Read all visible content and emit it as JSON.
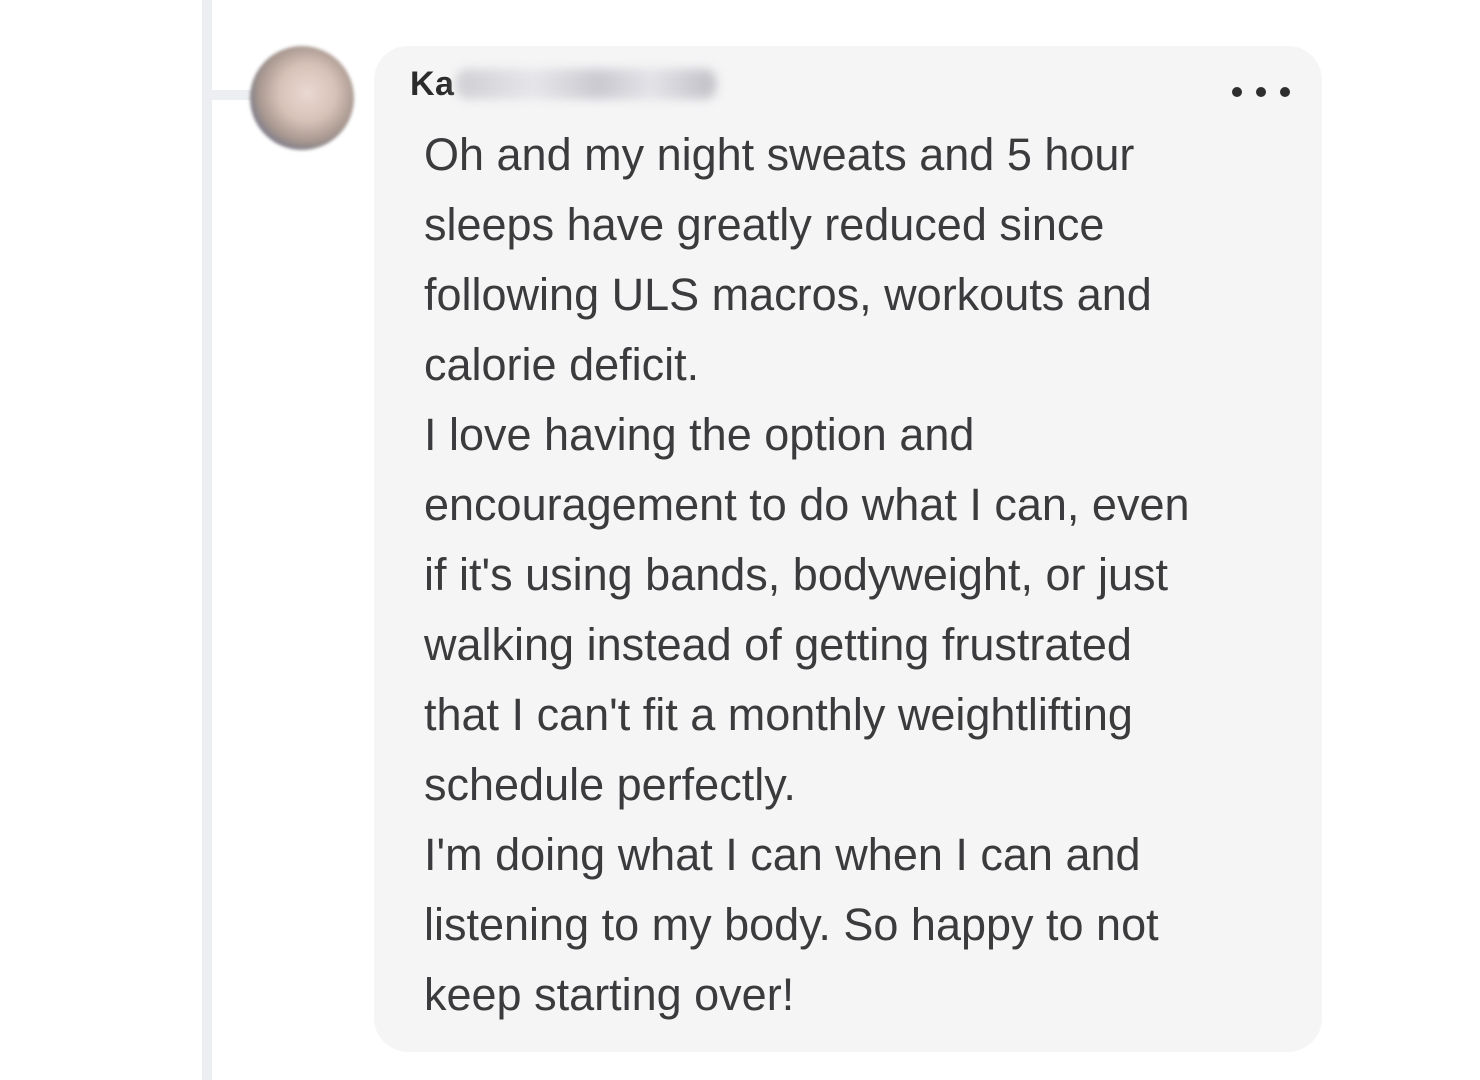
{
  "comment": {
    "author_visible": "Ka",
    "author_redacted": true,
    "more_options_icon": "ellipsis-icon",
    "lines": [
      "Oh and my night sweats and 5 hour",
      "sleeps have greatly reduced since",
      "following ULS macros, workouts and",
      "calorie deficit.",
      "I love having the option and",
      "encouragement to do what I can, even",
      "if it's using bands, bodyweight, or just",
      "walking instead of getting frustrated",
      "that I can't fit a monthly weightlifting",
      "schedule perfectly.",
      "I'm doing what I can when I can and",
      "listening to my body. So happy to not",
      "keep starting over!"
    ]
  },
  "colors": {
    "bubble_background": "#f5f5f6",
    "text": "#3b3b3d",
    "thread_line": "#eceef1"
  }
}
